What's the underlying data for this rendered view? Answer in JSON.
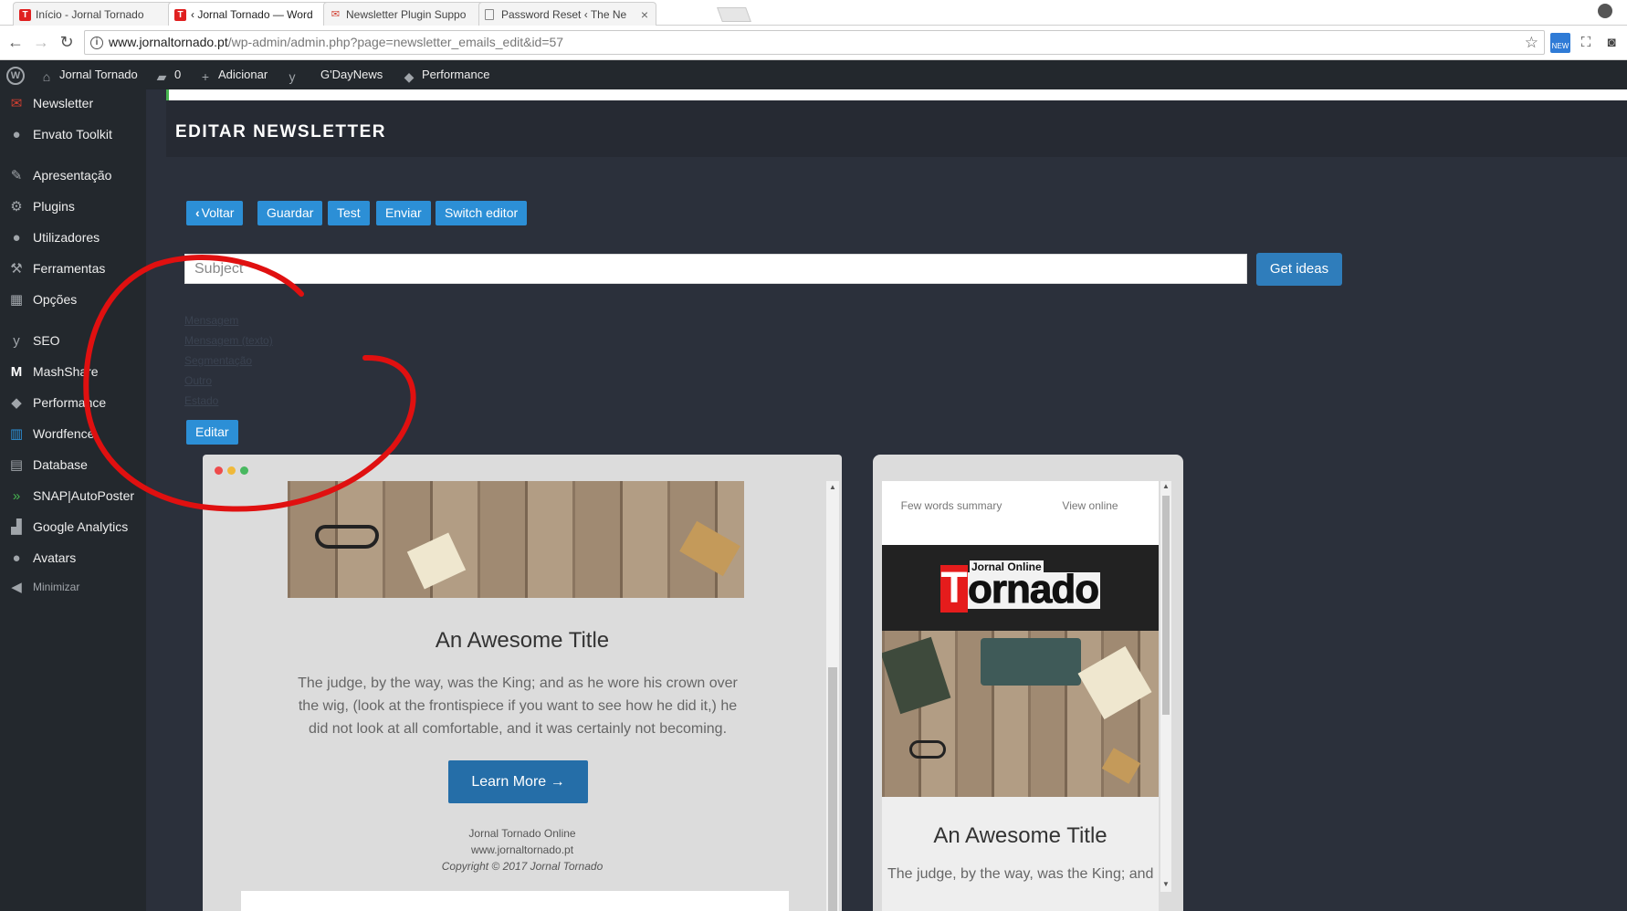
{
  "browser": {
    "tabs": [
      {
        "title": "Início - Jornal Tornado",
        "active": false
      },
      {
        "title": "‹ Jornal Tornado — Word",
        "active": true
      },
      {
        "title": "Newsletter Plugin Suppo",
        "active": false
      },
      {
        "title": "Password Reset ‹ The Ne",
        "active": false
      }
    ],
    "url_host": "www.jornaltornado.pt",
    "url_path": "/wp-admin/admin.php?page=newsletter_emails_edit&id=57",
    "new_badge": "NEW"
  },
  "adminbar": {
    "site_name": "Jornal Tornado",
    "comments_count": "0",
    "add_label": "Adicionar",
    "gdaynews_label": "G'DayNews",
    "performance_label": "Performance"
  },
  "sidebar": {
    "items": [
      {
        "label": "Newsletter",
        "icon": "newsletter-icon"
      },
      {
        "label": "Envato Toolkit",
        "icon": "envato-icon"
      },
      {
        "label": "Apresentação",
        "icon": "brush-icon"
      },
      {
        "label": "Plugins",
        "icon": "plugin-icon"
      },
      {
        "label": "Utilizadores",
        "icon": "users-icon"
      },
      {
        "label": "Ferramentas",
        "icon": "wrench-icon"
      },
      {
        "label": "Opções",
        "icon": "settings-icon"
      },
      {
        "label": "SEO",
        "icon": "yoast-icon"
      },
      {
        "label": "MashShare",
        "icon": "mashshare-icon"
      },
      {
        "label": "Performance",
        "icon": "performance-icon"
      },
      {
        "label": "Wordfence",
        "icon": "wordfence-icon"
      },
      {
        "label": "Database",
        "icon": "database-icon"
      },
      {
        "label": "SNAP|AutoPoster",
        "icon": "snap-icon"
      },
      {
        "label": "Google Analytics",
        "icon": "analytics-icon"
      },
      {
        "label": "Avatars",
        "icon": "avatar-icon"
      },
      {
        "label": "Minimizar",
        "icon": "collapse-icon"
      }
    ]
  },
  "page": {
    "title": "EDITAR NEWSLETTER",
    "buttons": {
      "back": "Voltar",
      "save": "Guardar",
      "test": "Test",
      "send": "Enviar",
      "switch_editor": "Switch editor"
    },
    "subject_placeholder": "Subject",
    "get_ideas": "Get ideas",
    "tabs": [
      "Mensagem",
      "Mensagem (texto)",
      "Segmentação",
      "Outro",
      "Estado"
    ],
    "edit_button": "Editar"
  },
  "preview_desktop": {
    "title": "An Awesome Title",
    "body": "The judge, by the way, was the King; and as he wore his crown over the wig, (look at the frontispiece if you want to see how he did it,) he did not look at all comfortable, and it was certainly not becoming.",
    "cta": "Learn More →",
    "footer_name": "Jornal Tornado Online",
    "footer_url": "www.jornaltornado.pt",
    "footer_copyright": "Copyright © 2017 Jornal Tornado"
  },
  "preview_mobile": {
    "summary_link": "Few words summary",
    "view_online": "View online",
    "logo_online": "Jornal Online",
    "logo_t": "T",
    "logo_rest": "ornado",
    "title": "An Awesome Title",
    "body": "The judge, by the way, was the King; and"
  },
  "colors": {
    "wp_dark": "#23282d",
    "content_bg": "#2b303b",
    "button_blue": "#2c8fd6",
    "cta_blue": "#256ea8",
    "annotation_red": "#e01010"
  }
}
